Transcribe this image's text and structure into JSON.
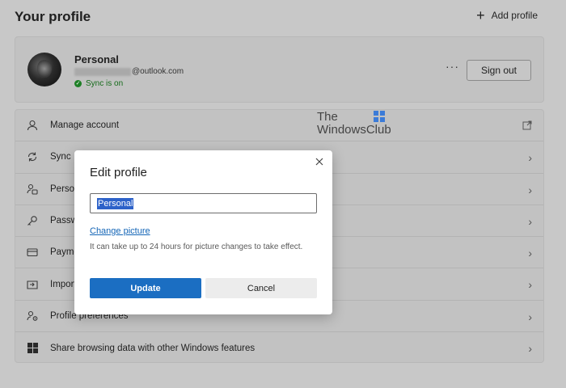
{
  "header": {
    "title": "Your profile",
    "add_profile_label": "Add profile"
  },
  "profile": {
    "name": "Personal",
    "email_suffix": "@outlook.com",
    "sync_status": "Sync is on",
    "more_label": "···",
    "sign_out_label": "Sign out"
  },
  "settings": {
    "items": [
      {
        "label": "Manage account",
        "icon": "person-icon",
        "trail": "external-link-icon"
      },
      {
        "label": "Sync",
        "icon": "sync-icon",
        "trail": "chevron-right-icon"
      },
      {
        "label": "Person",
        "icon": "personal-info-icon",
        "trail": "chevron-right-icon"
      },
      {
        "label": "Passwo",
        "icon": "key-icon",
        "trail": "chevron-right-icon"
      },
      {
        "label": "Payme",
        "icon": "card-icon",
        "trail": "chevron-right-icon"
      },
      {
        "label": "Import",
        "icon": "import-icon",
        "trail": "chevron-right-icon"
      },
      {
        "label": "Profile preferences",
        "icon": "people-settings-icon",
        "trail": "chevron-right-icon"
      },
      {
        "label": "Share browsing data with other Windows features",
        "icon": "windows-icon",
        "trail": "chevron-right-icon"
      }
    ]
  },
  "watermark": {
    "line1": "The",
    "line2": "WindowsClub"
  },
  "dialog": {
    "title": "Edit profile",
    "name_value": "Personal",
    "change_picture_label": "Change picture",
    "hint": "It can take up to 24 hours for picture changes to take effect.",
    "update_label": "Update",
    "cancel_label": "Cancel"
  },
  "colors": {
    "accent": "#1b6ec2",
    "link": "#1264b6",
    "sync_green": "#1d7f25",
    "overlay_bg": "#c8c8c8"
  }
}
